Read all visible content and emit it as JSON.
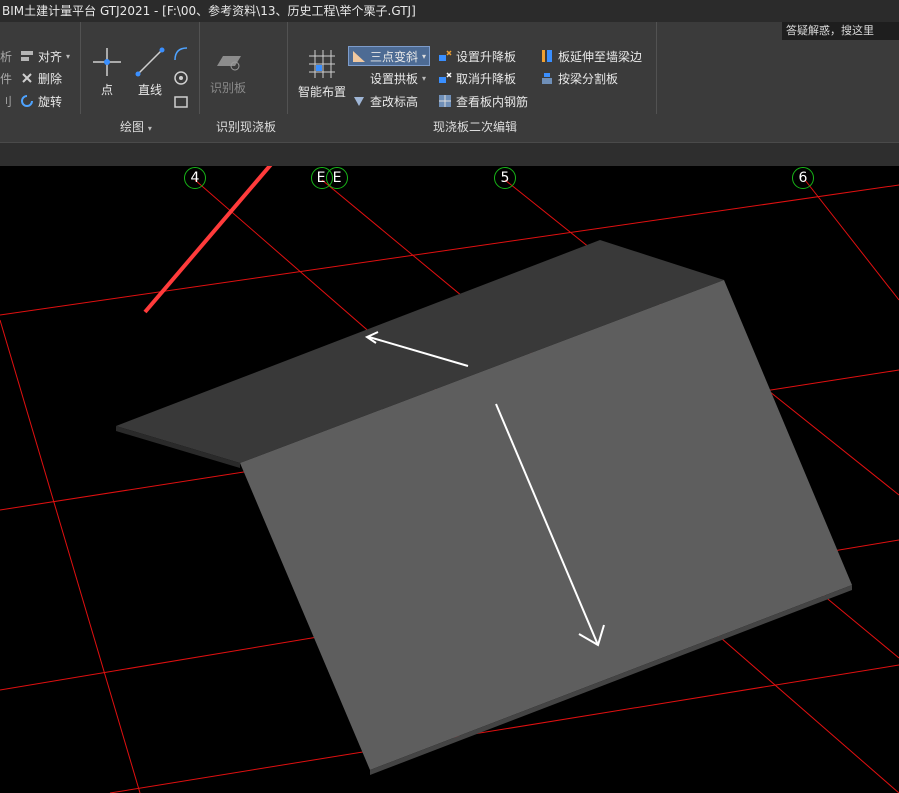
{
  "window": {
    "title": "BIM土建计量平台 GTJ2021 - [F:\\00、参考资料\\13、历史工程\\举个栗子.GTJ]",
    "help_search": "答疑解惑，搜这里"
  },
  "ribbon": {
    "modify_group": {
      "items": [
        {
          "label": "对齐",
          "icon": "align-icon",
          "has_dropdown": true
        },
        {
          "label": "删除",
          "icon": "delete-icon"
        },
        {
          "label": "旋转",
          "icon": "rotate-icon"
        }
      ],
      "partial_left": [
        "析",
        "件",
        "刂"
      ]
    },
    "draw_group": {
      "label": "绘图",
      "point": "点",
      "line": "直线"
    },
    "identify_group": {
      "label": "识别现浇板",
      "identify_board": "识别板"
    },
    "slab_edit_group": {
      "label": "现浇板二次编辑",
      "smart_layout": "智能布置",
      "items_col1": [
        {
          "label": "三点变斜",
          "icon": "three-point-slope-icon",
          "active": true
        },
        {
          "label": "设置拱板",
          "icon": "arch-slab-icon",
          "has_dropdown": true
        },
        {
          "label": "查改标高",
          "icon": "elevation-icon"
        }
      ],
      "items_col2": [
        {
          "label": "设置升降板",
          "icon": "raise-lower-icon"
        },
        {
          "label": "取消升降板",
          "icon": "cancel-raise-lower-icon"
        },
        {
          "label": "查看板内钢筋",
          "icon": "rebar-view-icon"
        }
      ],
      "items_col3": [
        {
          "label": "板延伸至墙梁边",
          "icon": "extend-slab-icon"
        },
        {
          "label": "按梁分割板",
          "icon": "split-by-beam-icon"
        }
      ]
    }
  },
  "viewport": {
    "axis_labels": [
      "4",
      "E",
      "E",
      "5",
      "6"
    ],
    "colors": {
      "background": "#000000",
      "grid": "#e01010",
      "axis_circle": "#17b517",
      "slab_top": "#393939",
      "slab_front": "#5e5e5e",
      "annotation_arrow": "#ff3b3b"
    }
  }
}
